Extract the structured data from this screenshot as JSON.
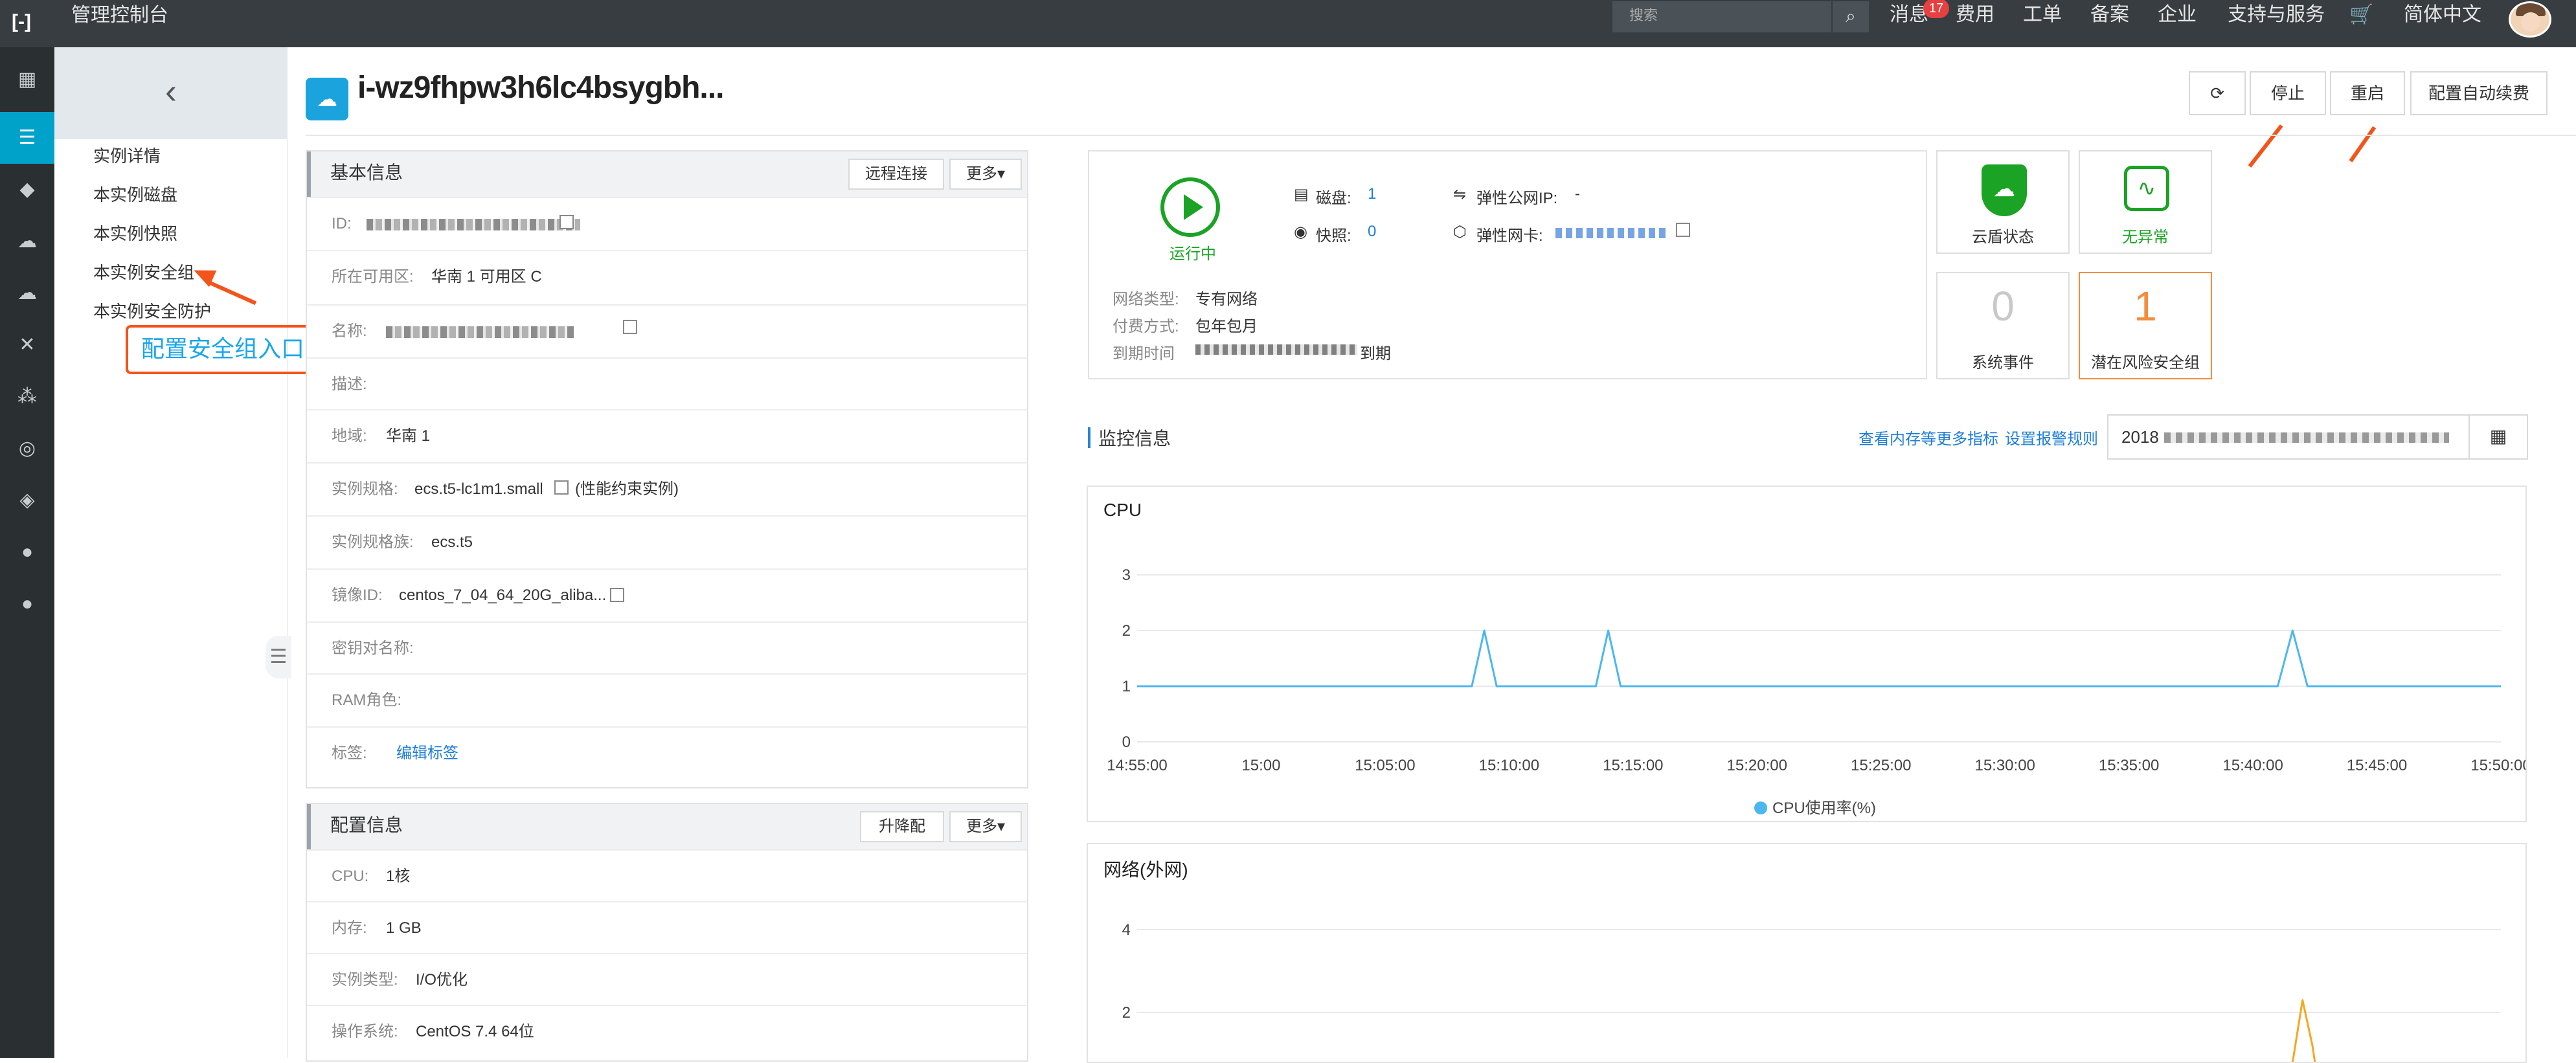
{
  "topbar": {
    "logo": "[-]",
    "title": "管理控制台",
    "search_placeholder": "搜索",
    "nav": [
      "消息",
      "费用",
      "工单",
      "备案",
      "企业",
      "支持与服务",
      "简体中文"
    ],
    "message_badge": "17"
  },
  "icon_sidebar": [
    "grid-icon",
    "list-icon",
    "cube-icon",
    "cloud-icon",
    "cloud-download-icon",
    "share-icon",
    "nodes-icon",
    "globe-icon",
    "box-icon",
    "circle-icon",
    "circle-icon"
  ],
  "subnav": {
    "items": [
      "实例详情",
      "本实例磁盘",
      "本实例快照",
      "本实例安全组",
      "本实例安全防护"
    ],
    "annotation": "配置安全组入口"
  },
  "header": {
    "instance_name": "i-wz9fhpw3h6lc4bsygbh...",
    "buttons": [
      "停止",
      "重启",
      "配置自动续费"
    ]
  },
  "basic_info": {
    "title": "基本信息",
    "remote_btn": "远程连接",
    "more_btn": "更多",
    "rows": [
      {
        "k": "ID:",
        "v": ""
      },
      {
        "k": "所在可用区:",
        "v": "华南 1 可用区 C"
      },
      {
        "k": "名称:",
        "v": ""
      },
      {
        "k": "描述:",
        "v": ""
      },
      {
        "k": "地域:",
        "v": "华南 1"
      },
      {
        "k": "实例规格:",
        "v": "ecs.t5-lc1m1.small",
        "extra": "(性能约束实例)"
      },
      {
        "k": "实例规格族:",
        "v": "ecs.t5"
      },
      {
        "k": "镜像ID:",
        "v": "centos_7_04_64_20G_aliba..."
      },
      {
        "k": "密钥对名称:",
        "v": ""
      },
      {
        "k": "RAM角色:",
        "v": ""
      },
      {
        "k": "标签:",
        "v": "编辑标签"
      }
    ]
  },
  "config_info": {
    "title": "配置信息",
    "upgrade_btn": "升降配",
    "more_btn": "更多",
    "rows": [
      {
        "k": "CPU:",
        "v": "1核"
      },
      {
        "k": "内存:",
        "v": "1 GB"
      },
      {
        "k": "实例类型:",
        "v": "I/O优化"
      },
      {
        "k": "操作系统:",
        "v": "CentOS 7.4 64位"
      }
    ]
  },
  "status": {
    "running": "运行中",
    "disk_label": "磁盘:",
    "disk_value": "1",
    "snapshot_label": "快照:",
    "snapshot_value": "0",
    "eip_label": "弹性公网IP:",
    "eip_value": "-",
    "eni_label": "弹性网卡:",
    "net_type_label": "网络类型:",
    "net_type": "专有网络",
    "pay_label": "付费方式:",
    "pay": "包年包月",
    "expire_label": "到期时间",
    "expire_suffix": "到期"
  },
  "cards": {
    "shield": "云盾状态",
    "health": "无异常",
    "events_count": "0",
    "events": "系统事件",
    "risk_count": "1",
    "risk": "潜在风险安全组"
  },
  "monitor": {
    "title": "监控信息",
    "more_metrics": "查看内存等更多指标",
    "alarm": "设置报警规则",
    "date_prefix": "2018"
  },
  "chart_data": [
    {
      "type": "line",
      "title": "CPU",
      "x": [
        "14:55:00",
        "15:00",
        "15:05:00",
        "15:10:00",
        "15:15:00",
        "15:20:00",
        "15:25:00",
        "15:30:00",
        "15:35:00",
        "15:40:00",
        "15:45:00",
        "15:50:00"
      ],
      "yticks": [
        0,
        1,
        2,
        3
      ],
      "ylim": [
        0,
        3
      ],
      "series": [
        {
          "name": "CPU使用率(%)",
          "color": "#4cb7ee",
          "points": [
            [
              0,
              1
            ],
            [
              13.5,
              1
            ],
            [
              14,
              2
            ],
            [
              14.5,
              1
            ],
            [
              18.5,
              1
            ],
            [
              19,
              2
            ],
            [
              19.5,
              1
            ],
            [
              46,
              1
            ],
            [
              46.6,
              2
            ],
            [
              47.2,
              1
            ],
            [
              55,
              1
            ]
          ]
        }
      ],
      "legend": "bottom-center"
    },
    {
      "type": "line",
      "title": "网络(外网)",
      "yticks": [
        2,
        4
      ],
      "ylim": [
        0,
        4
      ],
      "series": [
        {
          "color": "#f5a623",
          "points": [
            [
              46.2,
              0
            ],
            [
              46.6,
              0.8
            ],
            [
              47.0,
              2.3
            ],
            [
              47.4,
              1.2
            ],
            [
              47.7,
              0
            ]
          ]
        }
      ]
    }
  ]
}
